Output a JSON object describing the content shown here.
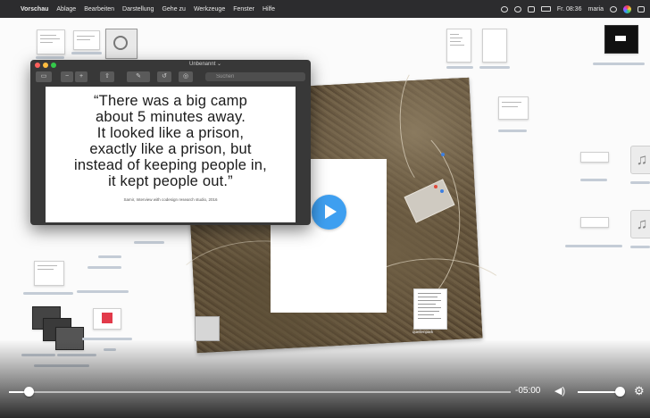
{
  "menubar": {
    "app_name": "Vorschau",
    "items": [
      "Ablage",
      "Bearbeiten",
      "Darstellung",
      "Gehe zu",
      "Werkzeuge",
      "Fenster",
      "Hilfe"
    ],
    "clock": "Fr. 08:36",
    "user": "maria"
  },
  "preview_window": {
    "title": "Unbenannt ⌄",
    "search_placeholder": "Suchen",
    "quote": "“There was a big camp\nabout  5 minutes away.\nIt looked like a prison,\nexactly like a prison, but\ninstead of keeping people in,\nit kept people out.”",
    "citation": "Samir, Interview with codesign research studio, 2016"
  },
  "map": {
    "label": "quellenpark"
  },
  "video": {
    "time_remaining": "-05:00",
    "progress": 0.04,
    "volume": 0.92,
    "play_color": "#3e9ff0"
  },
  "icons": [
    "apple-icon",
    "play-icon",
    "volume-icon",
    "gear-icon",
    "music-file-icon",
    "search-icon"
  ]
}
